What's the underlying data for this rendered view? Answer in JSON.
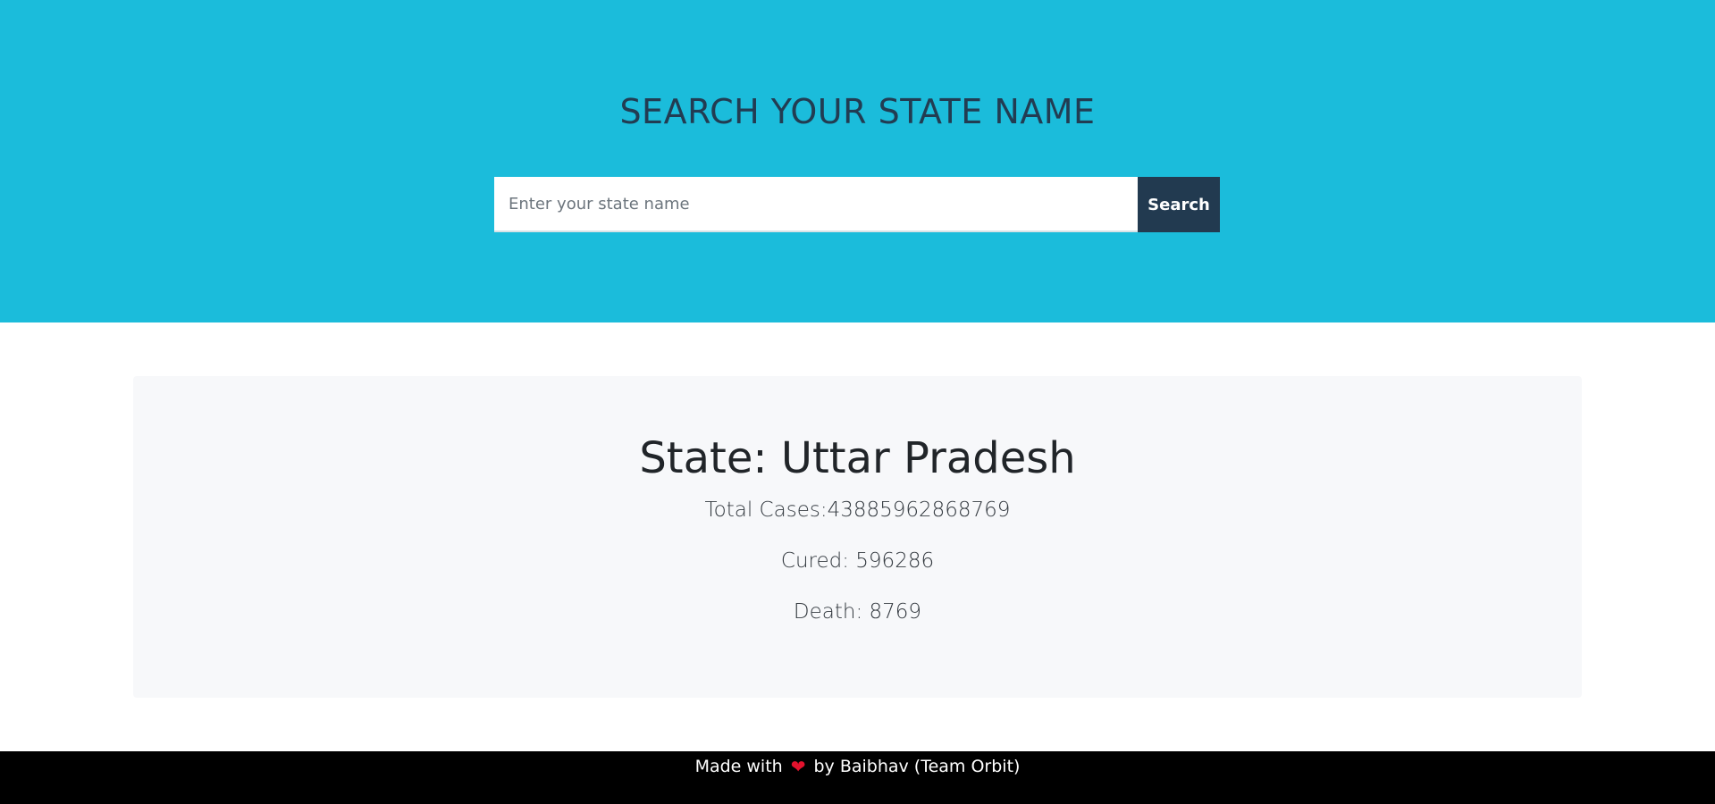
{
  "header": {
    "title": "SEARCH YOUR STATE NAME",
    "background_color": "#1bbcdb"
  },
  "search": {
    "placeholder": "Enter your state name",
    "value": "",
    "button_label": "Search",
    "button_color": "#223a50"
  },
  "result": {
    "state_heading": "State: Uttar Pradesh",
    "total_cases": "Total Cases:43885962868769",
    "cured": "Cured: 596286",
    "death": "Death: 8769"
  },
  "footer": {
    "made_with": "Made with",
    "heart_icon": "heart-icon",
    "by_text": "by Baibhav (Team Orbit)"
  }
}
